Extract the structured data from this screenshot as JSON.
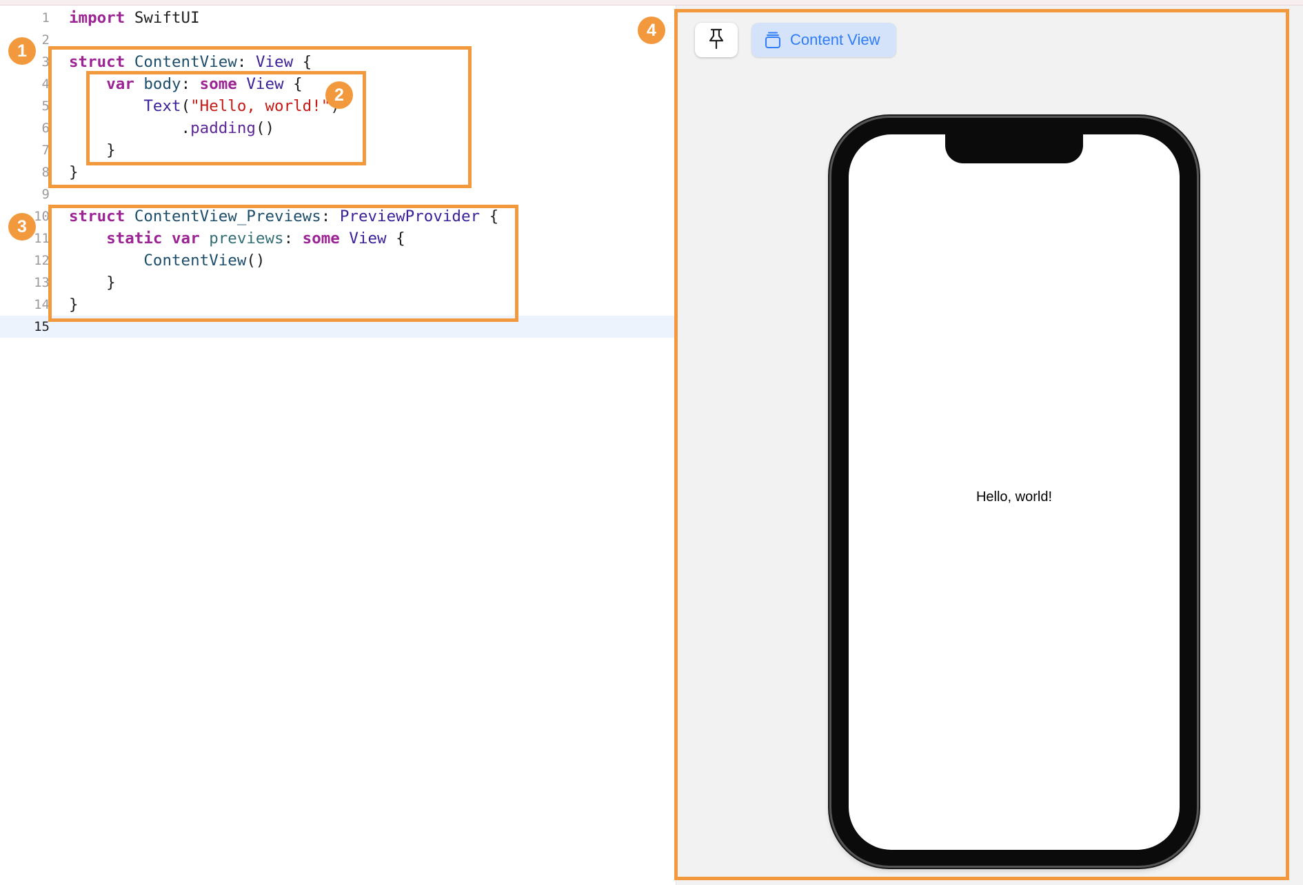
{
  "editor": {
    "lines": [
      {
        "num": "1",
        "tokens": [
          {
            "t": "import",
            "c": "kw"
          },
          {
            "t": " SwiftUI",
            "c": "pl"
          }
        ]
      },
      {
        "num": "2",
        "tokens": []
      },
      {
        "num": "3",
        "tokens": [
          {
            "t": "struct",
            "c": "kw"
          },
          {
            "t": " ",
            "c": "pl"
          },
          {
            "t": "ContentView",
            "c": "tn"
          },
          {
            "t": ": ",
            "c": "pl"
          },
          {
            "t": "View",
            "c": "ty"
          },
          {
            "t": " {",
            "c": "pl"
          }
        ]
      },
      {
        "num": "4",
        "tokens": [
          {
            "t": "    ",
            "c": "pl"
          },
          {
            "t": "var",
            "c": "kw"
          },
          {
            "t": " ",
            "c": "pl"
          },
          {
            "t": "body",
            "c": "tn"
          },
          {
            "t": ": ",
            "c": "pl"
          },
          {
            "t": "some",
            "c": "kw"
          },
          {
            "t": " ",
            "c": "pl"
          },
          {
            "t": "View",
            "c": "ty"
          },
          {
            "t": " {",
            "c": "pl"
          }
        ]
      },
      {
        "num": "5",
        "tokens": [
          {
            "t": "        ",
            "c": "pl"
          },
          {
            "t": "Text",
            "c": "ty"
          },
          {
            "t": "(",
            "c": "pl"
          },
          {
            "t": "\"Hello, world!\"",
            "c": "st"
          },
          {
            "t": ")",
            "c": "pl"
          }
        ]
      },
      {
        "num": "6",
        "tokens": [
          {
            "t": "            .",
            "c": "pl"
          },
          {
            "t": "padding",
            "c": "fn"
          },
          {
            "t": "()",
            "c": "pl"
          }
        ]
      },
      {
        "num": "7",
        "tokens": [
          {
            "t": "    }",
            "c": "pl"
          }
        ]
      },
      {
        "num": "8",
        "tokens": [
          {
            "t": "}",
            "c": "pl"
          }
        ]
      },
      {
        "num": "9",
        "tokens": []
      },
      {
        "num": "10",
        "tokens": [
          {
            "t": "struct",
            "c": "kw"
          },
          {
            "t": " ",
            "c": "pl"
          },
          {
            "t": "ContentView_Previews",
            "c": "tn"
          },
          {
            "t": ": ",
            "c": "pl"
          },
          {
            "t": "PreviewProvider",
            "c": "ty"
          },
          {
            "t": " {",
            "c": "pl"
          }
        ]
      },
      {
        "num": "11",
        "tokens": [
          {
            "t": "    ",
            "c": "pl"
          },
          {
            "t": "static",
            "c": "kw"
          },
          {
            "t": " ",
            "c": "pl"
          },
          {
            "t": "var",
            "c": "kw"
          },
          {
            "t": " ",
            "c": "pl"
          },
          {
            "t": "previews",
            "c": "pr"
          },
          {
            "t": ": ",
            "c": "pl"
          },
          {
            "t": "some",
            "c": "kw"
          },
          {
            "t": " ",
            "c": "pl"
          },
          {
            "t": "View",
            "c": "ty"
          },
          {
            "t": " {",
            "c": "pl"
          }
        ]
      },
      {
        "num": "12",
        "tokens": [
          {
            "t": "        ",
            "c": "pl"
          },
          {
            "t": "ContentView",
            "c": "tn"
          },
          {
            "t": "()",
            "c": "pl"
          }
        ]
      },
      {
        "num": "13",
        "tokens": [
          {
            "t": "    }",
            "c": "pl"
          }
        ]
      },
      {
        "num": "14",
        "tokens": [
          {
            "t": "}",
            "c": "pl"
          }
        ]
      },
      {
        "num": "15",
        "tokens": [],
        "current": true
      }
    ]
  },
  "preview": {
    "content_view_label": "Content View",
    "pin_icon": "pin-icon",
    "stack_icon": "stack-icon",
    "device_text": "Hello, world!"
  },
  "annotations": [
    {
      "label": "1"
    },
    {
      "label": "2"
    },
    {
      "label": "3"
    },
    {
      "label": "4"
    }
  ],
  "colors": {
    "annotation": "#f2993e",
    "keyword": "#9b2393",
    "type": "#3a1f98",
    "string": "#c41a16",
    "accent": "#2f7cf6"
  }
}
